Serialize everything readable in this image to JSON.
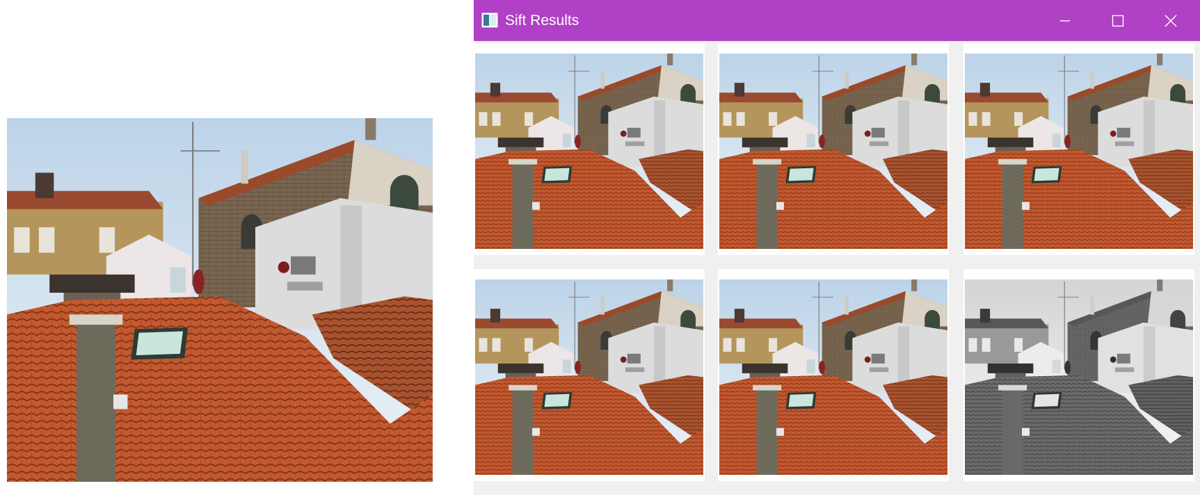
{
  "query_image": {
    "name": "query-rooftops-photo"
  },
  "window": {
    "title": "Sift Results",
    "controls": {
      "minimize": "minimize-icon",
      "maximize": "maximize-icon",
      "close": "close-icon"
    },
    "title_bar_color": "#b041c6"
  },
  "results": [
    {
      "name": "result-1",
      "grayscale": false
    },
    {
      "name": "result-2",
      "grayscale": false
    },
    {
      "name": "result-3",
      "grayscale": false
    },
    {
      "name": "result-4",
      "grayscale": false
    },
    {
      "name": "result-5",
      "grayscale": false
    },
    {
      "name": "result-6",
      "grayscale": true
    }
  ]
}
